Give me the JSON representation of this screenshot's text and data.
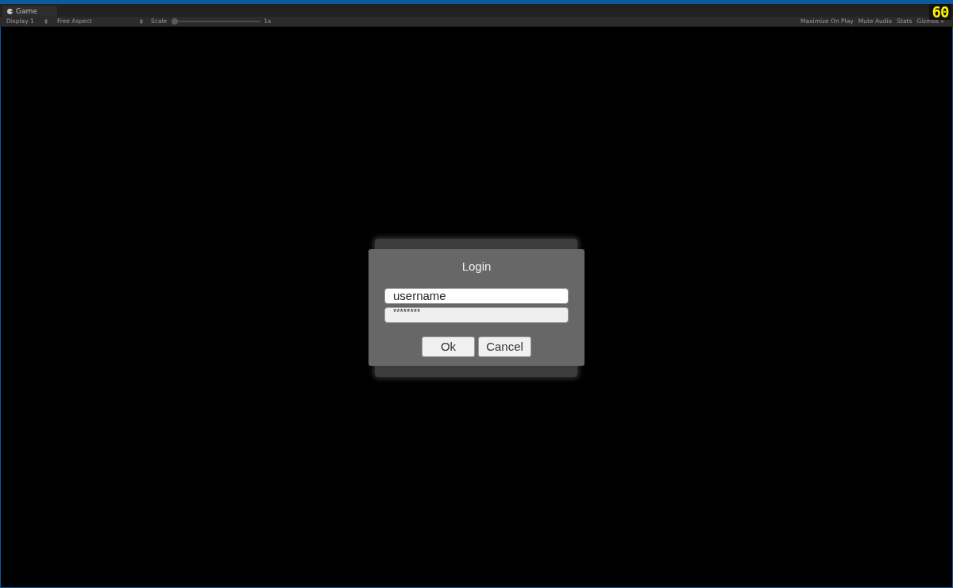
{
  "tabs": [
    {
      "label": "Game",
      "selected": true
    }
  ],
  "toolbar": {
    "display": "Display 1",
    "aspect": "Free Aspect",
    "scale": {
      "label": "Scale",
      "level": 0,
      "reading": "1x"
    },
    "toggles": [
      {
        "label": "Maximize On Play",
        "kind": "toggle",
        "on": false
      },
      {
        "label": "Mute Audio",
        "kind": "toggle",
        "on": false
      },
      {
        "label": "Stats",
        "kind": "toggle",
        "on": false
      },
      {
        "label": "Gizmos",
        "kind": "dropdown",
        "on": false
      }
    ]
  },
  "fps_counter": "60",
  "dialog": {
    "title": "Login",
    "username": {
      "value": "username"
    },
    "password": {
      "value": "********"
    },
    "buttons": [
      "Ok",
      "Cancel"
    ]
  }
}
